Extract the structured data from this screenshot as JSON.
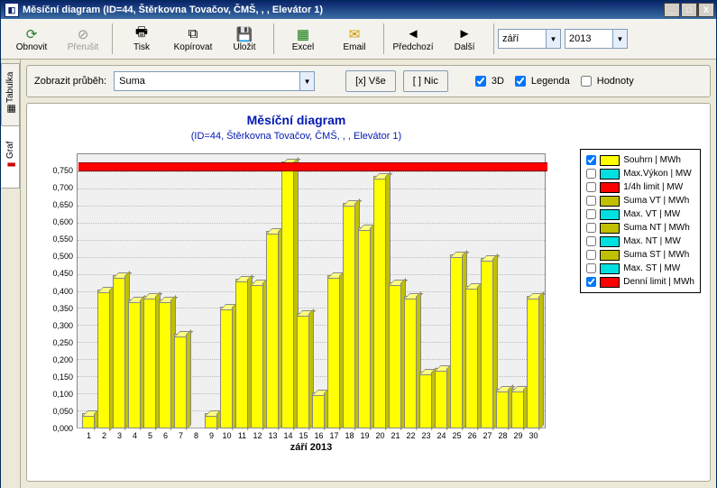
{
  "window": {
    "title": "Měsíční diagram (ID=44, Štěrkovna Tovačov, ČMŠ, , , Elevátor 1)",
    "minimize": "_",
    "maximize": "□",
    "close": "X"
  },
  "toolbar": {
    "obnovit": "Obnovit",
    "prerusit": "Přerušit",
    "tisk": "Tisk",
    "kopirovat": "Kopírovat",
    "ulozit": "Uložit",
    "excel": "Excel",
    "email": "Email",
    "predchozi": "Předchozí",
    "dalsi": "Další",
    "month": "září",
    "year": "2013"
  },
  "tabs": {
    "tabulka": "Tabulka",
    "graf": "Graf"
  },
  "optbar": {
    "zobrazit_label": "Zobrazit průběh:",
    "suma": "Suma",
    "vse": "[x] Vše",
    "nic": "[ ] Nic",
    "threeD": "3D",
    "legenda": "Legenda",
    "hodnoty": "Hodnoty"
  },
  "chart": {
    "title": "Měsíční diagram",
    "subtitle": "(ID=44, Štěrkovna Tovačov, ČMŠ, , , Elevátor 1)",
    "xlabel": "září 2013"
  },
  "legend": [
    {
      "label": "Souhrn | MWh",
      "color": "#ffff00",
      "checked": true
    },
    {
      "label": "Max.Výkon | MW",
      "color": "#00e0e0",
      "checked": false
    },
    {
      "label": "1/4h limit | MW",
      "color": "#ff0000",
      "checked": false
    },
    {
      "label": "Suma VT | MWh",
      "color": "#c0c000",
      "checked": false
    },
    {
      "label": "Max. VT | MW",
      "color": "#00e0e0",
      "checked": false
    },
    {
      "label": "Suma NT | MWh",
      "color": "#c0c000",
      "checked": false
    },
    {
      "label": "Max. NT | MW",
      "color": "#00e0e0",
      "checked": false
    },
    {
      "label": "Suma ST | MWh",
      "color": "#c0c000",
      "checked": false
    },
    {
      "label": "Max. ST | MW",
      "color": "#00e0e0",
      "checked": false
    },
    {
      "label": "Denní limit | MWh",
      "color": "#ff0000",
      "checked": true
    }
  ],
  "chart_data": {
    "type": "bar",
    "categories": [
      1,
      2,
      3,
      4,
      5,
      6,
      7,
      8,
      9,
      10,
      11,
      12,
      13,
      14,
      15,
      16,
      17,
      18,
      19,
      20,
      21,
      22,
      23,
      24,
      25,
      26,
      27,
      28,
      29,
      30
    ],
    "values": [
      0.04,
      0.4,
      0.44,
      0.37,
      0.38,
      0.37,
      0.27,
      0.0,
      0.04,
      0.35,
      0.43,
      0.42,
      0.57,
      0.77,
      0.33,
      0.1,
      0.44,
      0.65,
      0.58,
      0.73,
      0.42,
      0.38,
      0.16,
      0.17,
      0.5,
      0.41,
      0.49,
      0.11,
      0.11,
      0.38
    ],
    "limit": 0.775,
    "title": "Měsíční diagram",
    "xlabel": "září 2013",
    "ylabel": "",
    "ylim": [
      0,
      0.8
    ],
    "yticks": [
      0.0,
      0.05,
      0.1,
      0.15,
      0.2,
      0.25,
      0.3,
      0.35,
      0.4,
      0.45,
      0.5,
      0.55,
      0.6,
      0.65,
      0.7,
      0.75
    ]
  }
}
